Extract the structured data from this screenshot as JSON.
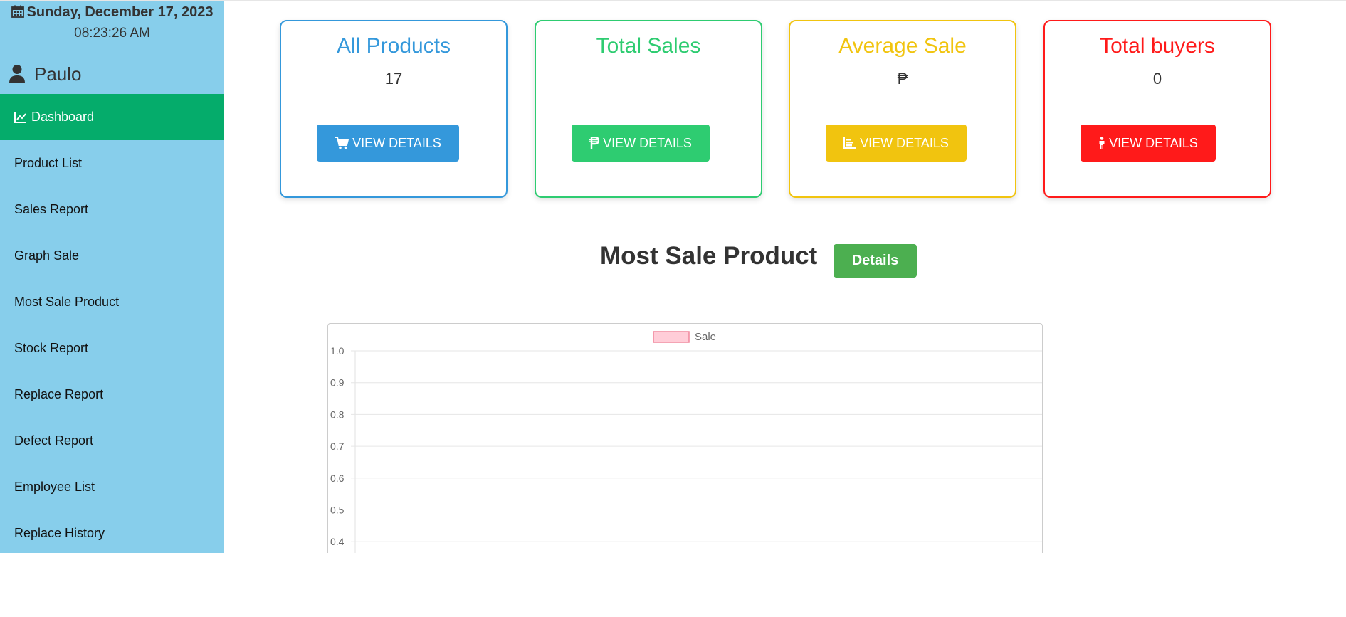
{
  "sidebar": {
    "date": "Sunday, December 17, 2023",
    "time": "08:23:26 AM",
    "user": "Paulo",
    "items": [
      {
        "label": "Dashboard"
      },
      {
        "label": "Product List"
      },
      {
        "label": "Sales Report"
      },
      {
        "label": "Graph Sale"
      },
      {
        "label": "Most Sale Product"
      },
      {
        "label": "Stock Report"
      },
      {
        "label": "Replace Report"
      },
      {
        "label": "Defect Report"
      },
      {
        "label": "Employee List"
      },
      {
        "label": "Replace History"
      }
    ]
  },
  "cards": [
    {
      "title": "All Products",
      "value": "17",
      "button": "VIEW DETAILS",
      "icon": "cart-icon",
      "color": "#3498db"
    },
    {
      "title": "Total Sales",
      "value": "",
      "button": "VIEW DETAILS",
      "icon": "peso-icon",
      "color": "#2ecc71"
    },
    {
      "title": "Average Sale",
      "value": "₱",
      "button": "VIEW DETAILS",
      "icon": "bar-chart-icon",
      "color": "#f1c40f"
    },
    {
      "title": "Total buyers",
      "value": "0",
      "button": "VIEW DETAILS",
      "icon": "person-icon",
      "color": "#ff1a1a"
    }
  ],
  "section": {
    "title": "Most Sale Product",
    "details_label": "Details"
  },
  "chart_data": {
    "type": "bar",
    "categories": [],
    "series": [
      {
        "name": "Sale",
        "values": []
      }
    ],
    "ylim": [
      0,
      1.0
    ],
    "yticks": [
      "1.0",
      "0.9",
      "0.8",
      "0.7",
      "0.6",
      "0.5",
      "0.4"
    ],
    "grid": true,
    "legend": "top",
    "legend_color": "#ffcdd8",
    "legend_border": "#f0869c"
  }
}
